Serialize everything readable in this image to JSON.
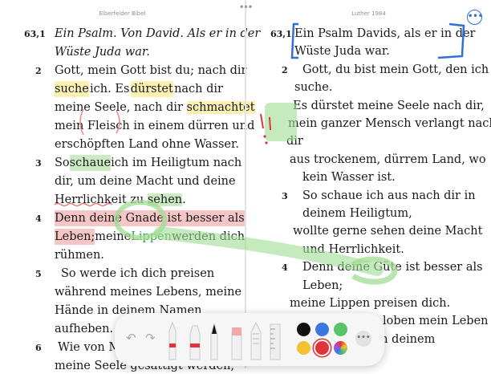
{
  "left": {
    "title": "Elberfelder Bibel",
    "verses": [
      {
        "num": "63,1",
        "lines": [
          [
            {
              "t": "Ein Psalm. Von David. Als er in der",
              "s": "it"
            }
          ],
          [
            {
              "t": "Wüste Juda war.",
              "s": "it"
            }
          ]
        ]
      },
      {
        "num": "2",
        "lines": [
          [
            {
              "t": "Gott, mein Gott bist du; nach dir"
            }
          ],
          [
            {
              "t": "suche",
              "s": "hl-y"
            },
            {
              "t": " ich. Es "
            },
            {
              "t": "dürstet",
              "s": "hl-y"
            },
            {
              "t": " nach dir"
            }
          ],
          [
            {
              "t": "meine Seele, nach dir "
            },
            {
              "t": "schmachtet",
              "s": "hl-y"
            }
          ],
          [
            {
              "t": "mein Fleisch in einem dürren und"
            }
          ],
          [
            {
              "t": "erschöpften Land ohne Wasser."
            }
          ]
        ]
      },
      {
        "num": "3",
        "lines": [
          [
            {
              "t": "So "
            },
            {
              "t": "schaue",
              "s": "hl-g"
            },
            {
              "t": " ich im Heiligtum nach"
            }
          ],
          [
            {
              "t": "dir, um deine Macht und deine"
            }
          ],
          [
            {
              "t": "Herrlichkeit zu "
            },
            {
              "t": "sehen",
              "s": "hl-g"
            },
            {
              "t": "."
            }
          ]
        ]
      },
      {
        "num": "4",
        "lines": [
          [
            {
              "t": "Denn deine Gnade ist besser als",
              "s": "hl-r"
            }
          ],
          [
            {
              "t": "Leben;",
              "s": "hl-r"
            },
            {
              "t": " meine "
            },
            {
              "t": "Lippen",
              "s": "green-txt"
            },
            {
              "t": " werden dich"
            }
          ],
          [
            {
              "t": "rühmen."
            }
          ]
        ]
      },
      {
        "num": "5",
        "lines": [
          [
            {
              "t": "So werde ich dich preisen"
            }
          ],
          [
            {
              "t": "während meines Lebens, meine"
            }
          ],
          [
            {
              "t": "Hände in deinem Namen"
            }
          ],
          [
            {
              "t": "aufheben."
            }
          ]
        ]
      },
      {
        "num": "6",
        "lines": [
          [
            {
              "t": "Wie von M"
            }
          ],
          [
            {
              "t": "meine Seele gesättigt werden,"
            }
          ]
        ]
      }
    ]
  },
  "right": {
    "title": "Luther 1984",
    "more_icon": "more-icon",
    "verses": [
      {
        "num": "63,1",
        "lines": [
          [
            {
              "t": "Ein Psalm Davids, als er in der"
            }
          ],
          [
            {
              "t": "Wüste Juda war."
            }
          ]
        ]
      },
      {
        "num": "2",
        "lines": [
          [
            {
              "t": "Gott, du bist mein Gott, den ich"
            }
          ],
          [
            {
              "t": "suche."
            }
          ],
          [
            {
              "t": "Es dürstet meine Seele nach dir,"
            }
          ],
          [
            {
              "t": "mein ganzer Mensch verlangt nach"
            }
          ],
          [
            {
              "t": "dir"
            }
          ],
          [
            {
              "t": "aus trockenem, dürrem Land, wo"
            }
          ],
          [
            {
              "t": "kein Wasser ist."
            }
          ]
        ]
      },
      {
        "num": "3",
        "lines": [
          [
            {
              "t": "So schaue ich aus nach dir in"
            }
          ],
          [
            {
              "t": "deinem Heiligtum,"
            }
          ],
          [
            {
              "t": "wollte gerne sehen deine Macht"
            }
          ],
          [
            {
              "t": "und Herrlichkeit."
            }
          ]
        ]
      },
      {
        "num": "4",
        "lines": [
          [
            {
              "t": "Denn deine Güte ist besser als"
            }
          ],
          [
            {
              "t": "Leben;"
            }
          ],
          [
            {
              "t": "meine Lippen preisen dich."
            }
          ],
          [
            {
              "t": "loben mein Leben"
            }
          ],
          [
            {
              "t": "meine Hände in deinem"
            }
          ]
        ]
      }
    ]
  },
  "toolbar": {
    "undo_icon": "undo-icon",
    "redo_icon": "redo-icon",
    "tools": [
      "pen-tool",
      "marker-tool",
      "fineliner-tool",
      "eraser-tool",
      "pencil-tool",
      "ruler-tool"
    ],
    "colors": [
      "#111111",
      "#3a78e0",
      "#59c36a",
      "#f2c230",
      "#e0333a"
    ],
    "more_icon": "more-icon"
  }
}
